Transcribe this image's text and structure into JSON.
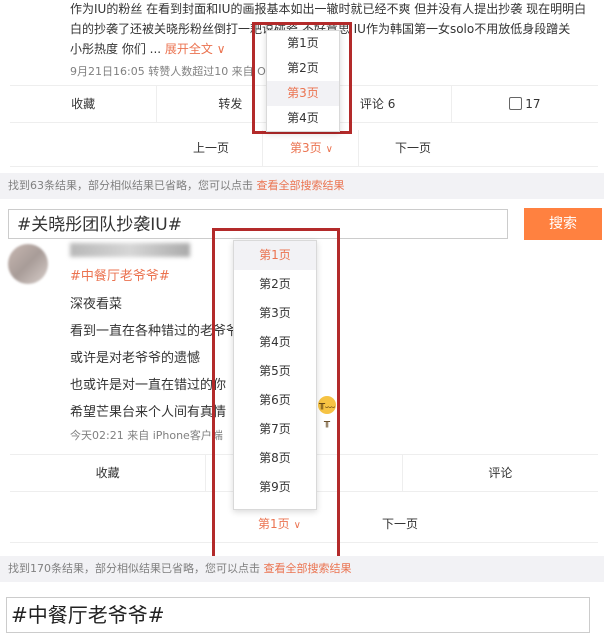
{
  "top_post": {
    "line1": "作为IU的粉丝 在看到封面和IU的画报基本如出一辙时就已经不爽 但并没有人提出抄袭 现在明明白",
    "line2": "白的抄袭了还被关晓彤粉丝倒打一耙说碰瓷 不好意思 IU作为韩国第一女solo不用放低身段蹭关",
    "line3_text": "小彤热度 你们 ...",
    "expand_label": "展开全文",
    "expand_caret": "∨",
    "meta": "9月21日16:05 转赞人数超过10 来自 OPPO",
    "actions": [
      "收藏",
      "转发",
      "评论 6",
      "17"
    ],
    "thumb_icon": "thumb-up-icon"
  },
  "top_pager": {
    "prev": "上一页",
    "current": "第3页",
    "next": "下一页",
    "caret": "∨"
  },
  "top_dropdown": {
    "items": [
      "第1页",
      "第2页",
      "第3页",
      "第4页"
    ],
    "selected": 2
  },
  "info1": {
    "text": "找到63条结果，部分相似结果已省略，您可以点击 ",
    "link": "查看全部搜索结果"
  },
  "search": {
    "query": "#关晓彤团队抄袭IU#",
    "button": "搜索"
  },
  "post2": {
    "topic": "#中餐厅老爷爷#",
    "lines": [
      "深夜看菜",
      "看到一直在各种错过的老爷爷，哭了",
      "或许是对老爷爷的遗憾",
      "也或许是对一直在错过的你",
      "希望芒果台来个人间有真情"
    ],
    "emoji": "crying-face-icon",
    "meta": "今天02:21 来自 iPhone客户端",
    "actions": [
      "收藏",
      "",
      "评论"
    ]
  },
  "bottom_pager": {
    "current": "第1页",
    "next": "下一页",
    "caret": "∨"
  },
  "bottom_dropdown": {
    "items": [
      "第1页",
      "第2页",
      "第3页",
      "第4页",
      "第5页",
      "第6页",
      "第7页",
      "第8页",
      "第9页"
    ],
    "selected": 0
  },
  "info2": {
    "text": "找到170条结果，部分相似结果已省略，您可以点击 ",
    "link": "查看全部搜索结果"
  },
  "bottom_search": {
    "query": "#中餐厅老爷爷#"
  },
  "colors": {
    "accent": "#eb7350",
    "button": "#ff8140",
    "highlight_frame": "#b32a2a"
  }
}
